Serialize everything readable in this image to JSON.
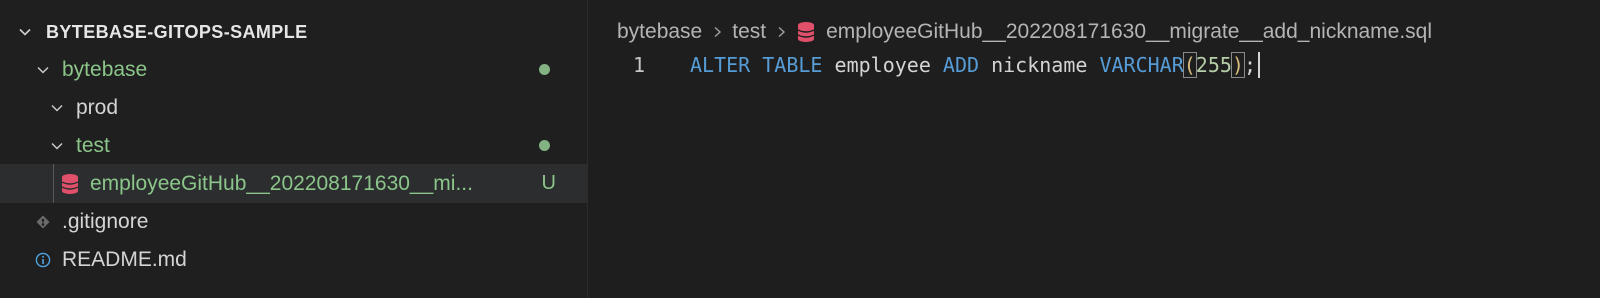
{
  "explorer": {
    "title": "BYTEBASE-GITOPS-SAMPLE",
    "items": [
      {
        "label": "bytebase"
      },
      {
        "label": "prod"
      },
      {
        "label": "test"
      },
      {
        "label": "employeeGitHub__202208171630__mi...",
        "status": "U"
      },
      {
        "label": ".gitignore"
      },
      {
        "label": "README.md"
      }
    ]
  },
  "editor": {
    "breadcrumb": [
      "bytebase",
      "test",
      "employeeGitHub__202208171630__migrate__add_nickname.sql"
    ],
    "line_number": "1",
    "tokens": {
      "alter": "ALTER",
      "table": "TABLE",
      "name": "employee",
      "add": "ADD",
      "column": "nickname",
      "type": "VARCHAR",
      "lparen": "(",
      "size": "255",
      "rparen": ")",
      "semi": ";"
    }
  },
  "colors": {
    "modified_green": "#8bc58a",
    "keyword_blue": "#569cd6",
    "sql_icon_red": "#e0506b"
  }
}
